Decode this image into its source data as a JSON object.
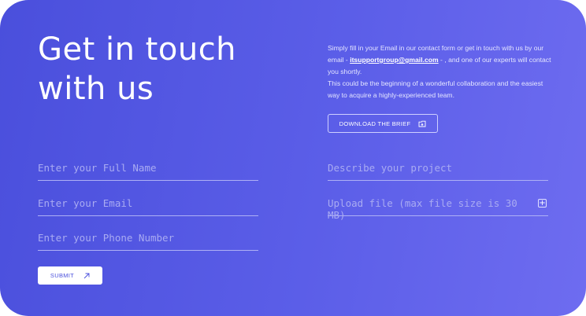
{
  "headline": {
    "line1": "Get in touch",
    "line2": "with us"
  },
  "intro": {
    "prefix": "Simply fill in your Email in our contact form or get in touch with us by our  email - ",
    "email": "itsupportgroup@gmail.com",
    "suffix": " - , and one of our experts will contact you shortly.",
    "line2": "This could be the beginning of a wonderful collaboration and the easiest way to acquire a highly-experienced team."
  },
  "brief_button": {
    "label": "DOWNLOAD THE BRIEF",
    "icon": "download-folder-icon"
  },
  "form": {
    "full_name_placeholder": "Enter your Full Name",
    "email_placeholder": "Enter your Email",
    "phone_placeholder": "Enter your Phone Number",
    "project_placeholder": "Describe your project",
    "upload_placeholder": "Upload file (max file size is 30 MB)",
    "upload_icon": "plus-icon"
  },
  "submit_button": {
    "label": "SUBMIT",
    "icon": "arrow-up-right-icon"
  },
  "colors": {
    "gradient_start": "#4a4fdc",
    "gradient_end": "#6e6cf0",
    "text": "#ffffff"
  }
}
